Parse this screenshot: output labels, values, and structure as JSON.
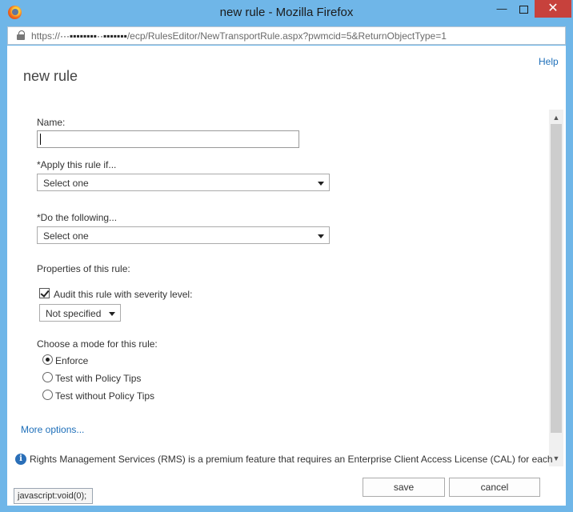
{
  "window": {
    "title": "new rule - Mozilla Firefox",
    "minimize_glyph": "—",
    "close_glyph": "✕"
  },
  "urlbar": {
    "url_prefix": "https://",
    "url_redacted": "···▪▪▪▪▪▪▪▪··▪▪▪▪▪▪▪",
    "url_path": "/ecp/RulesEditor/NewTransportRule.aspx?pwmcid=5&ReturnObjectType=1"
  },
  "dialog": {
    "help_label": "Help",
    "title": "new rule",
    "name_label": "Name:",
    "name_value": "",
    "apply_label": "*Apply this rule if...",
    "apply_select": "Select one",
    "do_label": "*Do the following...",
    "do_select": "Select one",
    "properties_label": "Properties of this rule:",
    "audit_label": "Audit this rule with severity level:",
    "audit_checked": true,
    "severity_select": "Not specified",
    "mode_label": "Choose a mode for this rule:",
    "modes": [
      {
        "label": "Enforce",
        "selected": true
      },
      {
        "label": "Test with Policy Tips",
        "selected": false
      },
      {
        "label": "Test without Policy Tips",
        "selected": false
      }
    ],
    "more_options": "More options...",
    "info_text": "Rights Management Services (RMS) is a premium feature that requires an Enterprise Client Access License (CAL) for each",
    "save_label": "save",
    "cancel_label": "cancel",
    "status_tip": "javascript:void(0);"
  },
  "icons": {
    "window": "firefox-logo",
    "url": "lock-icon",
    "info": "info-icon",
    "info_glyph": "i"
  }
}
